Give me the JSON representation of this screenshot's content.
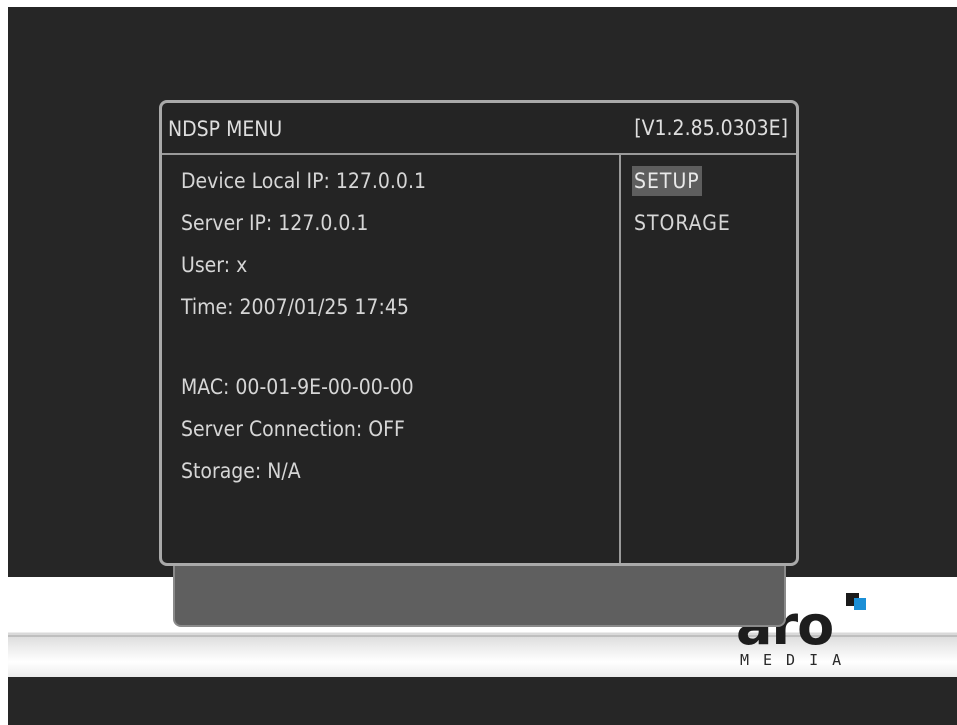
{
  "menu": {
    "title": "NDSP MENU",
    "version": "[V1.2.85.0303E]"
  },
  "info": {
    "device_local_ip": "Device Local IP: 127.0.0.1",
    "server_ip": "Server IP: 127.0.0.1",
    "user": "User: x",
    "time": "Time: 2007/01/25 17:45",
    "mac": "MAC: 00-01-9E-00-00-00",
    "server_connection": "Server Connection: OFF",
    "storage": "Storage: N/A"
  },
  "side_menu": {
    "items": [
      {
        "label": "SETUP",
        "selected": true
      },
      {
        "label": "STORAGE",
        "selected": false
      }
    ]
  },
  "logo": {
    "main": "aro",
    "sub": "MEDIA",
    "accent_color": "#1b8fd6"
  },
  "colors": {
    "background": "#262626",
    "text": "#d6d6d6",
    "border": "#a9a9a9",
    "highlight": "#5e5e5e"
  }
}
